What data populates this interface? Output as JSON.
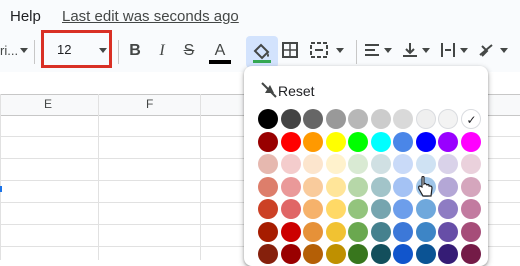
{
  "menu": {
    "help": "Help",
    "last_edit": "Last edit was seconds ago"
  },
  "toolbar": {
    "font_name": "ri...",
    "font_size": "12",
    "bold": "B",
    "italic": "I",
    "strikethrough": "S",
    "text_color": "A"
  },
  "grid": {
    "columns": [
      "E",
      "F"
    ]
  },
  "palette": {
    "reset_label": "Reset",
    "selected_color": "#ffffff",
    "rows": [
      [
        "#000000",
        "#434343",
        "#666666",
        "#999999",
        "#b7b7b7",
        "#cccccc",
        "#d9d9d9",
        "#efefef",
        "#f3f3f3",
        "#ffffff"
      ],
      [
        "#980000",
        "#ff0000",
        "#ff9900",
        "#ffff00",
        "#00ff00",
        "#00ffff",
        "#4a86e8",
        "#0000ff",
        "#9900ff",
        "#ff00ff"
      ],
      [
        "#e6b8af",
        "#f4cccc",
        "#fce5cd",
        "#fff2cc",
        "#d9ead3",
        "#d0e0e3",
        "#c9daf8",
        "#cfe2f3",
        "#d9d2e9",
        "#ead1dc"
      ],
      [
        "#dd7e6b",
        "#ea9999",
        "#f9cb9c",
        "#ffe599",
        "#b6d7a8",
        "#a2c4c9",
        "#a4c2f4",
        "#9fc5e8",
        "#b4a7d6",
        "#d5a6bd"
      ],
      [
        "#cc4125",
        "#e06666",
        "#f6b26b",
        "#ffd966",
        "#93c47d",
        "#76a5af",
        "#6d9eeb",
        "#6fa8dc",
        "#8e7cc3",
        "#c27ba0"
      ],
      [
        "#a61c00",
        "#cc0000",
        "#e69138",
        "#f1c232",
        "#6aa84f",
        "#45818e",
        "#3c78d8",
        "#3d85c6",
        "#674ea7",
        "#a64d79"
      ],
      [
        "#85200c",
        "#990000",
        "#b45f06",
        "#bf9000",
        "#38761d",
        "#134f5c",
        "#1155cc",
        "#0b5394",
        "#351c75",
        "#741b47"
      ]
    ]
  }
}
